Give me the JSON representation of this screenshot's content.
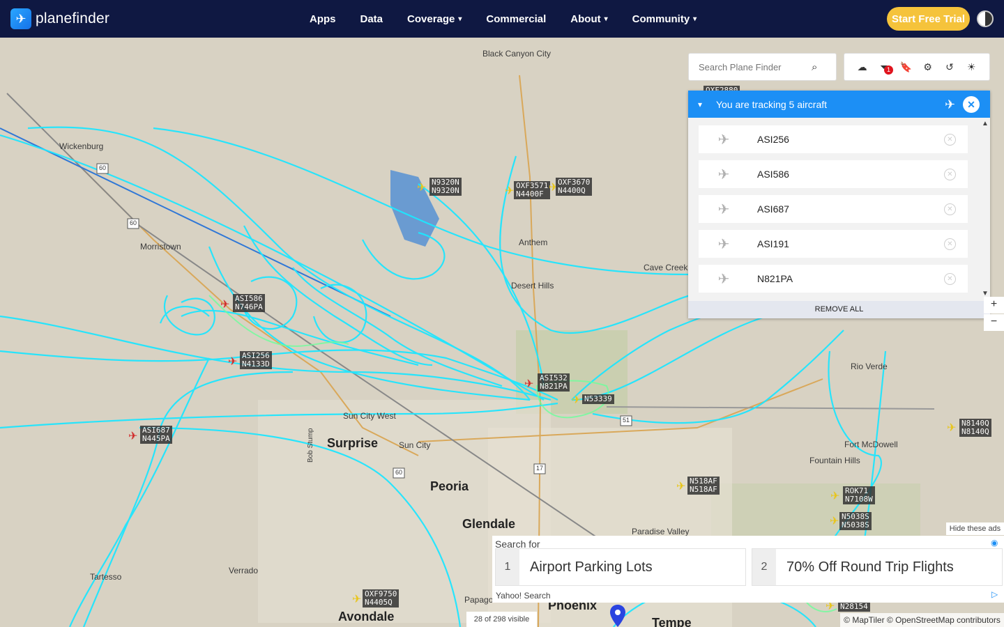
{
  "brand": {
    "name": "planefinder",
    "icon": "plane-logo-icon"
  },
  "nav": {
    "items": [
      {
        "label": "Apps",
        "dropdown": false
      },
      {
        "label": "Data",
        "dropdown": false
      },
      {
        "label": "Coverage",
        "dropdown": true
      },
      {
        "label": "Commercial",
        "dropdown": false
      },
      {
        "label": "About",
        "dropdown": true
      },
      {
        "label": "Community",
        "dropdown": true
      }
    ],
    "cta_label": "Start Free Trial"
  },
  "search": {
    "placeholder": "Search Plane Finder",
    "icon": "search-icon"
  },
  "toolbar": {
    "icons": [
      "cloud-upload-icon",
      "filter-icon",
      "bookmark-icon",
      "settings-icon",
      "history-icon",
      "weather-icon"
    ],
    "filter_badge": "1"
  },
  "tracking": {
    "title": "You are tracking 5 aircraft",
    "items": [
      "ASI256",
      "ASI586",
      "ASI687",
      "ASI191",
      "N821PA"
    ],
    "remove_all_label": "REMOVE ALL"
  },
  "zoom": {
    "in": "+",
    "out": "−"
  },
  "map": {
    "places": [
      {
        "name": "Black Canyon City"
      },
      {
        "name": "Wickenburg"
      },
      {
        "name": "Morristown"
      },
      {
        "name": "Anthem"
      },
      {
        "name": "Cave Creek"
      },
      {
        "name": "Desert Hills"
      },
      {
        "name": "Rio Verde"
      },
      {
        "name": "Fort McDowell"
      },
      {
        "name": "Fountain Hills"
      },
      {
        "name": "Surprise"
      },
      {
        "name": "Sun City"
      },
      {
        "name": "Sun City West"
      },
      {
        "name": "Peoria"
      },
      {
        "name": "Glendale"
      },
      {
        "name": "Paradise Valley"
      },
      {
        "name": "Tartesso"
      },
      {
        "name": "Verrado"
      },
      {
        "name": "Avondale"
      },
      {
        "name": "Phoenix"
      },
      {
        "name": "Tempe"
      },
      {
        "name": "Papago"
      },
      {
        "name": "Bob Stump"
      }
    ],
    "aircraft": [
      {
        "line1": "N9320N",
        "line2": "N9320N",
        "color": "yellow"
      },
      {
        "line1": "OXF3571",
        "line2": "N4400F",
        "color": "yellow"
      },
      {
        "line1": "OXF3670",
        "line2": "N4400Q",
        "color": "yellow"
      },
      {
        "line1": "ASI586",
        "line2": "N746PA",
        "color": "red"
      },
      {
        "line1": "ASI256",
        "line2": "N4133D",
        "color": "red"
      },
      {
        "line1": "ASI532",
        "line2": "N821PA",
        "color": "red"
      },
      {
        "line1": "N53339",
        "line2": "",
        "color": "yellow"
      },
      {
        "line1": "ASI687",
        "line2": "N445PA",
        "color": "red"
      },
      {
        "line1": "N8140Q",
        "line2": "N8140Q",
        "color": "yellow"
      },
      {
        "line1": "N518AF",
        "line2": "N518AF",
        "color": "yellow"
      },
      {
        "line1": "ROK71",
        "line2": "N7108W",
        "color": "yellow"
      },
      {
        "line1": "N5038S",
        "line2": "N5038S",
        "color": "yellow"
      },
      {
        "line1": "OXF9750",
        "line2": "N4405Q",
        "color": "yellow"
      },
      {
        "line1": "N28154",
        "line2": "",
        "color": "yellow"
      },
      {
        "line1": "OXF2880",
        "line2": "",
        "color": "yellow"
      }
    ],
    "route_shields": [
      "60",
      "60",
      "17",
      "51",
      "60"
    ]
  },
  "ads": {
    "hide_label": "Hide these ads",
    "search_for": "Search for",
    "items": [
      {
        "num": "1",
        "text": "Airport Parking Lots"
      },
      {
        "num": "2",
        "text": "70% Off Round Trip Flights"
      }
    ],
    "provider": "Yahoo! Search"
  },
  "status": {
    "visible_count": "28 of 298 visible"
  },
  "attribution": "© MapTiler © OpenStreetMap contributors",
  "colors": {
    "nav_bg": "#0f1842",
    "accent": "#1c8ff5",
    "cta": "#f5c33b",
    "track": "#1ee6ff"
  }
}
